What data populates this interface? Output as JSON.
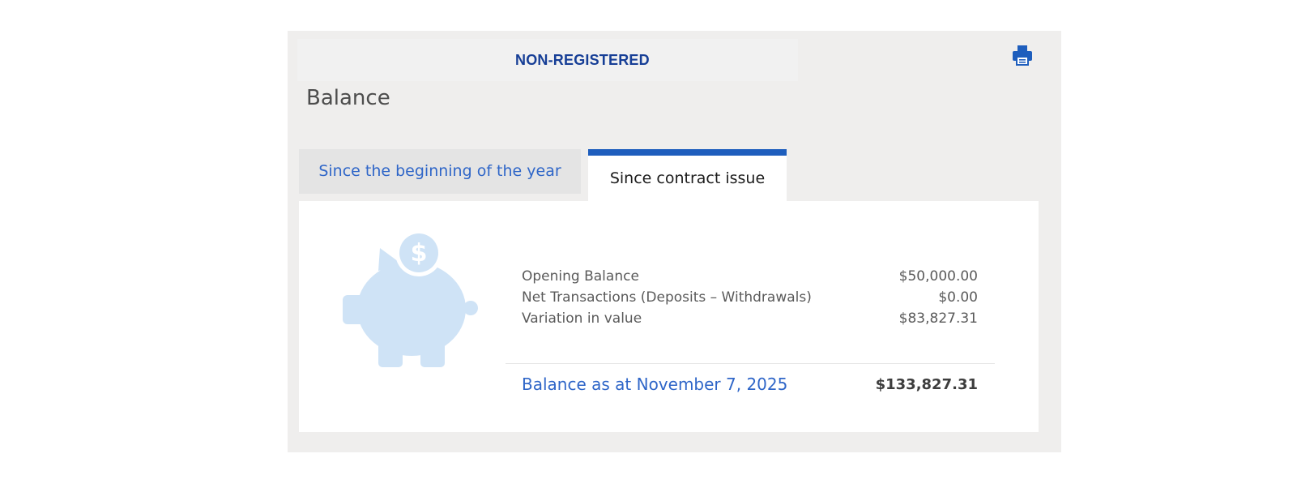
{
  "header": {
    "account_type": "NON-REGISTERED",
    "print_icon": "printer-icon"
  },
  "page": {
    "title": "Balance"
  },
  "tabs": [
    {
      "label": "Since the beginning of the year",
      "active": false
    },
    {
      "label": "Since contract issue",
      "active": true
    }
  ],
  "illustration": {
    "icon": "piggy-bank-dollar-icon",
    "symbol": "$",
    "color": "#cfe3f6"
  },
  "summary": {
    "rows": [
      {
        "label": "Opening Balance",
        "value": "$50,000.00"
      },
      {
        "label": "Net Transactions (Deposits – Withdrawals)",
        "value": "$0.00"
      },
      {
        "label": "Variation in value",
        "value": "$83,827.31"
      }
    ],
    "total": {
      "label": "Balance as at November 7, 2025",
      "value": "$133,827.31"
    }
  },
  "colors": {
    "accent": "#1e5ebd",
    "link": "#2f66c8",
    "panel_bg": "#efeeed"
  }
}
